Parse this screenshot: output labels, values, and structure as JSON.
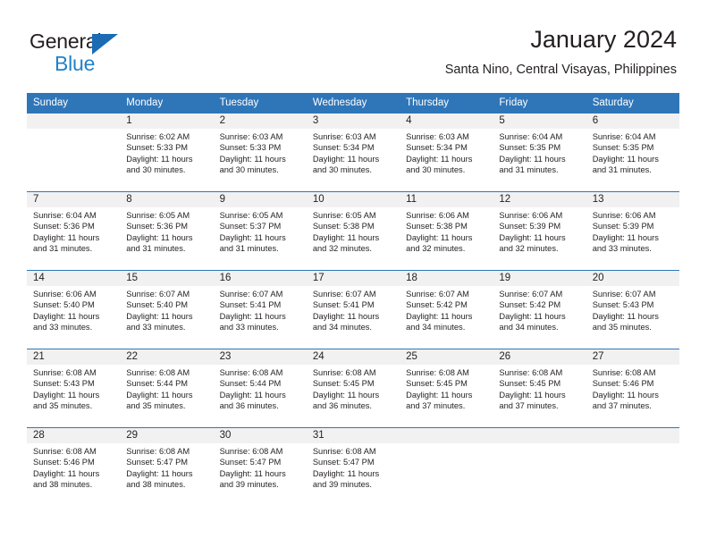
{
  "brand": {
    "name_part1": "General",
    "name_part2": "Blue",
    "accent_color": "#2282c8",
    "triangle_color": "#1b6cb5"
  },
  "header": {
    "title": "January 2024",
    "location": "Santa Nino, Central Visayas, Philippines",
    "header_bar_color": "#2f76b9",
    "day_band_color": "#f1f1f1"
  },
  "weekdays": [
    "Sunday",
    "Monday",
    "Tuesday",
    "Wednesday",
    "Thursday",
    "Friday",
    "Saturday"
  ],
  "weeks": [
    [
      {
        "day": "",
        "empty": true,
        "sunrise": "",
        "sunset": "",
        "daylight1": "",
        "daylight2": ""
      },
      {
        "day": "1",
        "sunrise": "Sunrise: 6:02 AM",
        "sunset": "Sunset: 5:33 PM",
        "daylight1": "Daylight: 11 hours",
        "daylight2": "and 30 minutes."
      },
      {
        "day": "2",
        "sunrise": "Sunrise: 6:03 AM",
        "sunset": "Sunset: 5:33 PM",
        "daylight1": "Daylight: 11 hours",
        "daylight2": "and 30 minutes."
      },
      {
        "day": "3",
        "sunrise": "Sunrise: 6:03 AM",
        "sunset": "Sunset: 5:34 PM",
        "daylight1": "Daylight: 11 hours",
        "daylight2": "and 30 minutes."
      },
      {
        "day": "4",
        "sunrise": "Sunrise: 6:03 AM",
        "sunset": "Sunset: 5:34 PM",
        "daylight1": "Daylight: 11 hours",
        "daylight2": "and 30 minutes."
      },
      {
        "day": "5",
        "sunrise": "Sunrise: 6:04 AM",
        "sunset": "Sunset: 5:35 PM",
        "daylight1": "Daylight: 11 hours",
        "daylight2": "and 31 minutes."
      },
      {
        "day": "6",
        "sunrise": "Sunrise: 6:04 AM",
        "sunset": "Sunset: 5:35 PM",
        "daylight1": "Daylight: 11 hours",
        "daylight2": "and 31 minutes."
      }
    ],
    [
      {
        "day": "7",
        "sunrise": "Sunrise: 6:04 AM",
        "sunset": "Sunset: 5:36 PM",
        "daylight1": "Daylight: 11 hours",
        "daylight2": "and 31 minutes."
      },
      {
        "day": "8",
        "sunrise": "Sunrise: 6:05 AM",
        "sunset": "Sunset: 5:36 PM",
        "daylight1": "Daylight: 11 hours",
        "daylight2": "and 31 minutes."
      },
      {
        "day": "9",
        "sunrise": "Sunrise: 6:05 AM",
        "sunset": "Sunset: 5:37 PM",
        "daylight1": "Daylight: 11 hours",
        "daylight2": "and 31 minutes."
      },
      {
        "day": "10",
        "sunrise": "Sunrise: 6:05 AM",
        "sunset": "Sunset: 5:38 PM",
        "daylight1": "Daylight: 11 hours",
        "daylight2": "and 32 minutes."
      },
      {
        "day": "11",
        "sunrise": "Sunrise: 6:06 AM",
        "sunset": "Sunset: 5:38 PM",
        "daylight1": "Daylight: 11 hours",
        "daylight2": "and 32 minutes."
      },
      {
        "day": "12",
        "sunrise": "Sunrise: 6:06 AM",
        "sunset": "Sunset: 5:39 PM",
        "daylight1": "Daylight: 11 hours",
        "daylight2": "and 32 minutes."
      },
      {
        "day": "13",
        "sunrise": "Sunrise: 6:06 AM",
        "sunset": "Sunset: 5:39 PM",
        "daylight1": "Daylight: 11 hours",
        "daylight2": "and 33 minutes."
      }
    ],
    [
      {
        "day": "14",
        "sunrise": "Sunrise: 6:06 AM",
        "sunset": "Sunset: 5:40 PM",
        "daylight1": "Daylight: 11 hours",
        "daylight2": "and 33 minutes."
      },
      {
        "day": "15",
        "sunrise": "Sunrise: 6:07 AM",
        "sunset": "Sunset: 5:40 PM",
        "daylight1": "Daylight: 11 hours",
        "daylight2": "and 33 minutes."
      },
      {
        "day": "16",
        "sunrise": "Sunrise: 6:07 AM",
        "sunset": "Sunset: 5:41 PM",
        "daylight1": "Daylight: 11 hours",
        "daylight2": "and 33 minutes."
      },
      {
        "day": "17",
        "sunrise": "Sunrise: 6:07 AM",
        "sunset": "Sunset: 5:41 PM",
        "daylight1": "Daylight: 11 hours",
        "daylight2": "and 34 minutes."
      },
      {
        "day": "18",
        "sunrise": "Sunrise: 6:07 AM",
        "sunset": "Sunset: 5:42 PM",
        "daylight1": "Daylight: 11 hours",
        "daylight2": "and 34 minutes."
      },
      {
        "day": "19",
        "sunrise": "Sunrise: 6:07 AM",
        "sunset": "Sunset: 5:42 PM",
        "daylight1": "Daylight: 11 hours",
        "daylight2": "and 34 minutes."
      },
      {
        "day": "20",
        "sunrise": "Sunrise: 6:07 AM",
        "sunset": "Sunset: 5:43 PM",
        "daylight1": "Daylight: 11 hours",
        "daylight2": "and 35 minutes."
      }
    ],
    [
      {
        "day": "21",
        "sunrise": "Sunrise: 6:08 AM",
        "sunset": "Sunset: 5:43 PM",
        "daylight1": "Daylight: 11 hours",
        "daylight2": "and 35 minutes."
      },
      {
        "day": "22",
        "sunrise": "Sunrise: 6:08 AM",
        "sunset": "Sunset: 5:44 PM",
        "daylight1": "Daylight: 11 hours",
        "daylight2": "and 35 minutes."
      },
      {
        "day": "23",
        "sunrise": "Sunrise: 6:08 AM",
        "sunset": "Sunset: 5:44 PM",
        "daylight1": "Daylight: 11 hours",
        "daylight2": "and 36 minutes."
      },
      {
        "day": "24",
        "sunrise": "Sunrise: 6:08 AM",
        "sunset": "Sunset: 5:45 PM",
        "daylight1": "Daylight: 11 hours",
        "daylight2": "and 36 minutes."
      },
      {
        "day": "25",
        "sunrise": "Sunrise: 6:08 AM",
        "sunset": "Sunset: 5:45 PM",
        "daylight1": "Daylight: 11 hours",
        "daylight2": "and 37 minutes."
      },
      {
        "day": "26",
        "sunrise": "Sunrise: 6:08 AM",
        "sunset": "Sunset: 5:45 PM",
        "daylight1": "Daylight: 11 hours",
        "daylight2": "and 37 minutes."
      },
      {
        "day": "27",
        "sunrise": "Sunrise: 6:08 AM",
        "sunset": "Sunset: 5:46 PM",
        "daylight1": "Daylight: 11 hours",
        "daylight2": "and 37 minutes."
      }
    ],
    [
      {
        "day": "28",
        "sunrise": "Sunrise: 6:08 AM",
        "sunset": "Sunset: 5:46 PM",
        "daylight1": "Daylight: 11 hours",
        "daylight2": "and 38 minutes."
      },
      {
        "day": "29",
        "sunrise": "Sunrise: 6:08 AM",
        "sunset": "Sunset: 5:47 PM",
        "daylight1": "Daylight: 11 hours",
        "daylight2": "and 38 minutes."
      },
      {
        "day": "30",
        "sunrise": "Sunrise: 6:08 AM",
        "sunset": "Sunset: 5:47 PM",
        "daylight1": "Daylight: 11 hours",
        "daylight2": "and 39 minutes."
      },
      {
        "day": "31",
        "sunrise": "Sunrise: 6:08 AM",
        "sunset": "Sunset: 5:47 PM",
        "daylight1": "Daylight: 11 hours",
        "daylight2": "and 39 minutes."
      },
      {
        "day": "",
        "empty": true,
        "sunrise": "",
        "sunset": "",
        "daylight1": "",
        "daylight2": ""
      },
      {
        "day": "",
        "empty": true,
        "sunrise": "",
        "sunset": "",
        "daylight1": "",
        "daylight2": ""
      },
      {
        "day": "",
        "empty": true,
        "sunrise": "",
        "sunset": "",
        "daylight1": "",
        "daylight2": ""
      }
    ]
  ]
}
